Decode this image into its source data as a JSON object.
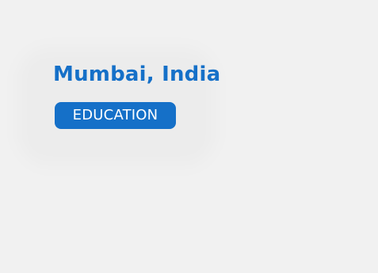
{
  "location": {
    "title": "Mumbai, India",
    "tag_label": "EDUCATION"
  },
  "colors": {
    "background": "#f1f1f1",
    "accent": "#1570c8",
    "tag_text": "#ffffff"
  }
}
